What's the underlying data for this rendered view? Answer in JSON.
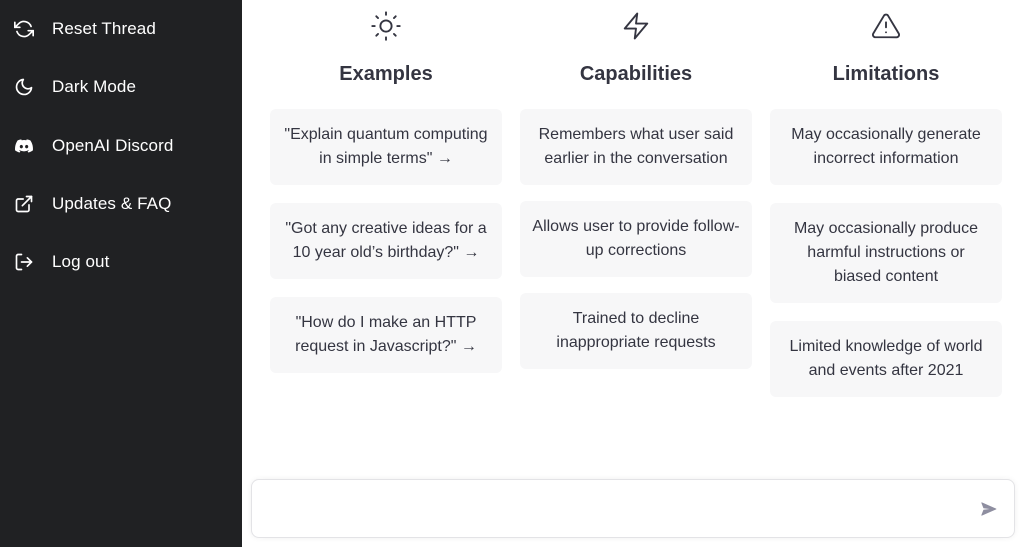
{
  "sidebar": {
    "items": [
      {
        "label": "Reset Thread",
        "icon": "refresh-icon"
      },
      {
        "label": "Dark Mode",
        "icon": "moon-icon"
      },
      {
        "label": "OpenAI Discord",
        "icon": "discord-icon"
      },
      {
        "label": "Updates & FAQ",
        "icon": "external-link-icon"
      },
      {
        "label": "Log out",
        "icon": "logout-icon"
      }
    ]
  },
  "columns": {
    "examples": {
      "title": "Examples",
      "icon": "sun-icon",
      "cards": [
        "\"Explain quantum computing in simple terms\" →",
        "\"Got any creative ideas for a 10 year old’s birthday?\" →",
        "\"How do I make an HTTP request in Javascript?\" →"
      ]
    },
    "capabilities": {
      "title": "Capabilities",
      "icon": "lightning-icon",
      "cards": [
        "Remembers what user said earlier in the conversation",
        "Allows user to provide follow-up corrections",
        "Trained to decline inappropriate requests"
      ]
    },
    "limitations": {
      "title": "Limitations",
      "icon": "warning-icon",
      "cards": [
        "May occasionally generate incorrect information",
        "May occasionally produce harmful instructions or biased content",
        "Limited knowledge of world and events after 2021"
      ]
    }
  },
  "composer": {
    "value": "",
    "placeholder": "",
    "send_icon": "send-icon"
  },
  "colors": {
    "sidebar_bg": "#202123",
    "sidebar_text": "#ffffff",
    "card_bg": "#f7f7f8",
    "text": "#343541"
  }
}
